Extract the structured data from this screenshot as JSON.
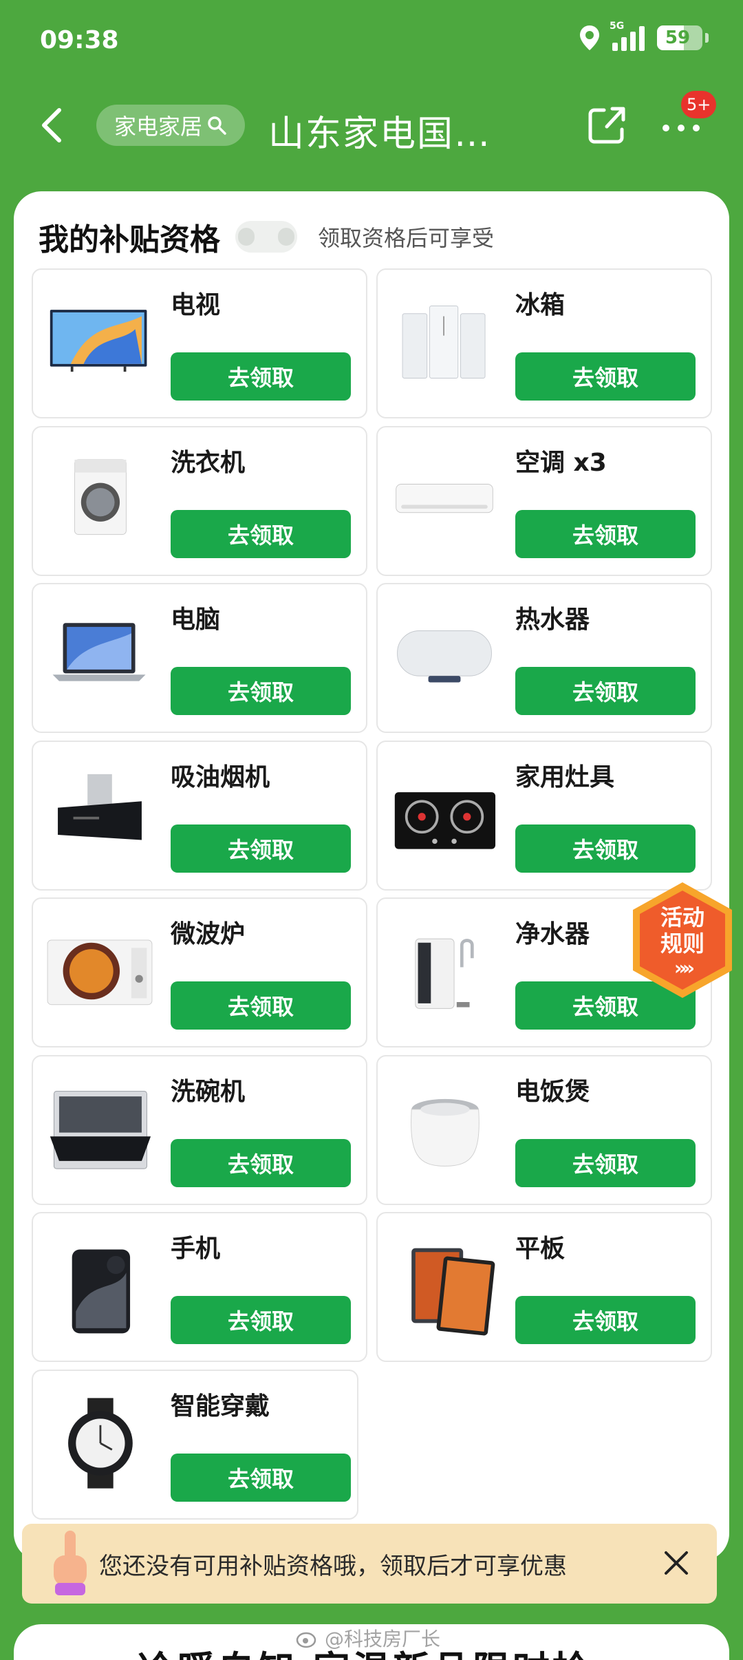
{
  "status_bar": {
    "time": "09:38",
    "network": "5G",
    "battery": "59",
    "battery_level": 0.59
  },
  "nav": {
    "search_label": "家电家居",
    "title": "山东家电国…",
    "badge": "5+"
  },
  "card": {
    "title": "我的补贴资格",
    "subtitle": "领取资格后可享受"
  },
  "items": [
    {
      "name": "电视",
      "button": "去领取",
      "icon": "tv-icon"
    },
    {
      "name": "冰箱",
      "button": "去领取",
      "icon": "refrigerator-icon"
    },
    {
      "name": "洗衣机",
      "button": "去领取",
      "icon": "washing-machine-icon"
    },
    {
      "name": "空调 x3",
      "button": "去领取",
      "icon": "air-conditioner-icon"
    },
    {
      "name": "电脑",
      "button": "去领取",
      "icon": "laptop-icon"
    },
    {
      "name": "热水器",
      "button": "去领取",
      "icon": "water-heater-icon"
    },
    {
      "name": "吸油烟机",
      "button": "去领取",
      "icon": "range-hood-icon"
    },
    {
      "name": "家用灶具",
      "button": "去领取",
      "icon": "gas-stove-icon"
    },
    {
      "name": "微波炉",
      "button": "去领取",
      "icon": "microwave-icon"
    },
    {
      "name": "净水器",
      "button": "去领取",
      "icon": "water-purifier-icon"
    },
    {
      "name": "洗碗机",
      "button": "去领取",
      "icon": "dishwasher-icon"
    },
    {
      "name": "电饭煲",
      "button": "去领取",
      "icon": "rice-cooker-icon"
    },
    {
      "name": "手机",
      "button": "去领取",
      "icon": "phone-icon"
    },
    {
      "name": "平板",
      "button": "去领取",
      "icon": "tablet-icon"
    },
    {
      "name": "智能穿戴",
      "button": "去领取",
      "icon": "smartwatch-icon"
    }
  ],
  "rules_badge": {
    "line1": "活动",
    "line2": "规则",
    "arrows": "»»"
  },
  "toast": {
    "text": "您还没有可用补贴资格哦，领取后才可享优惠"
  },
  "next_card": {
    "text": "冷暖自知 家温新品限时抢"
  },
  "watermark": "@科技房厂长",
  "colors": {
    "header_green": "#4da83f",
    "button_green": "#1aa84a",
    "toast_bg": "#f7e2b8",
    "badge_red": "#e8332c"
  }
}
